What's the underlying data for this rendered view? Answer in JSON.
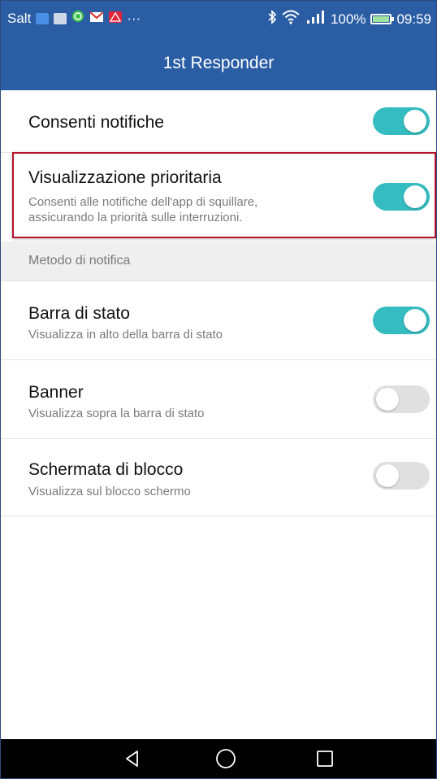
{
  "status_bar": {
    "carrier": "Salt",
    "dots": "···",
    "battery_percent": "100%",
    "battery_level": 1.0,
    "time": "09:59",
    "icons": [
      "gallery-icon",
      "image-icon",
      "whatsapp-icon",
      "gmail-icon",
      "warning-icon",
      "bluetooth-icon",
      "wifi-icon",
      "signal-icon",
      "battery-icon"
    ]
  },
  "header": {
    "title": "1st Responder"
  },
  "settings": [
    {
      "title": "Consenti notifiche",
      "subtitle": "",
      "enabled": true
    },
    {
      "title": "Visualizzazione prioritaria",
      "subtitle": "Consenti alle notifiche dell'app di squillare, assicurando la priorità sulle interruzioni.",
      "enabled": true
    }
  ],
  "section": {
    "label": "Metodo di notifica"
  },
  "methods": [
    {
      "title": "Barra di stato",
      "subtitle": "Visualizza in alto della barra di stato",
      "enabled": true
    },
    {
      "title": "Banner",
      "subtitle": "Visualizza sopra la barra di stato",
      "enabled": false
    },
    {
      "title": "Schermata di blocco",
      "subtitle": "Visualizza sul blocco schermo",
      "enabled": false
    }
  ],
  "nav": {
    "icons": [
      "back-icon",
      "home-icon",
      "recents-icon"
    ]
  },
  "colors": {
    "header_bg": "#2a5da4",
    "toggle_on": "#34bcc0",
    "toggle_off": "#e0e0e0",
    "highlight": "#b5122c"
  }
}
